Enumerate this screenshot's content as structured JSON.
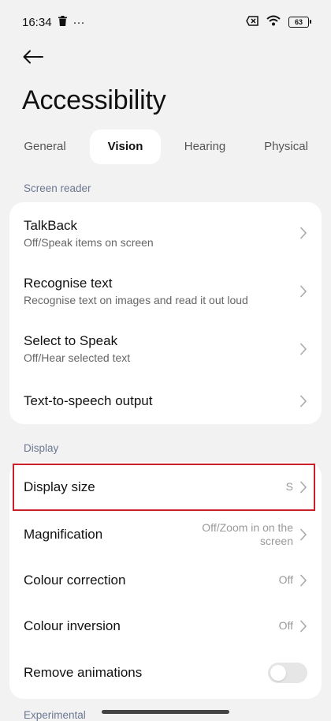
{
  "status_bar": {
    "time": "16:34",
    "more": "···",
    "battery": "63",
    "icons": [
      "trash-icon",
      "sim-x-icon",
      "wifi-icon",
      "battery-icon"
    ]
  },
  "header": {
    "title": "Accessibility",
    "back_icon": "arrow-left-icon"
  },
  "tabs": [
    {
      "label": "General",
      "active": false
    },
    {
      "label": "Vision",
      "active": true
    },
    {
      "label": "Hearing",
      "active": false
    },
    {
      "label": "Physical",
      "active": false
    }
  ],
  "screen_reader": {
    "label": "Screen reader",
    "items": [
      {
        "title": "TalkBack",
        "subtitle": "Off/Speak items on screen"
      },
      {
        "title": "Recognise text",
        "subtitle": "Recognise text on images and read it out loud"
      },
      {
        "title": "Select to Speak",
        "subtitle": "Off/Hear selected text"
      },
      {
        "title": "Text-to-speech output"
      }
    ]
  },
  "display": {
    "label": "Display",
    "items": [
      {
        "title": "Display size",
        "value": "S"
      },
      {
        "title": "Magnification",
        "value_line1": "Off/Zoom in on the",
        "value_line2": "screen"
      },
      {
        "title": "Colour correction",
        "value": "Off"
      },
      {
        "title": "Colour inversion",
        "value": "Off"
      },
      {
        "title": "Remove animations",
        "toggle_on": false
      }
    ]
  },
  "next_section": {
    "label": "Experimental"
  },
  "colors": {
    "background": "#f2f2f2",
    "card": "#ffffff",
    "section_label": "#6b7891",
    "highlight_border": "#cc1f2a"
  }
}
